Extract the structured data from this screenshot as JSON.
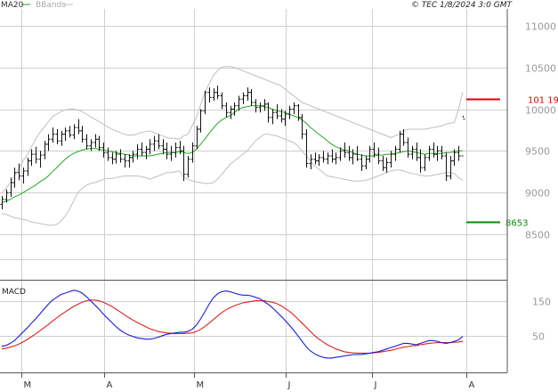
{
  "header": {
    "indicator_ma": "MA20",
    "indicator_bb": "BBands",
    "watermark": "© TEC 1/8/2024 3:0 GMT"
  },
  "colors": {
    "price_bars": "#111111",
    "ma20": "#22aa22",
    "bbands": "#c0c0c0",
    "macd_line": "#1a1adc",
    "signal_line": "#e02020",
    "resistance": "#e00000",
    "support": "#0a8a0a",
    "grid": "#cfcfcf",
    "axis_text": "#999999"
  },
  "chart_data": [
    {
      "type": "ohlc",
      "panel": "price",
      "ylim": [
        8000,
        11200
      ],
      "y_ticks": [
        {
          "value": 11000,
          "label": "11000"
        },
        {
          "value": 10500,
          "label": "10500"
        },
        {
          "value": 10000,
          "label": "10000"
        },
        {
          "value": 9500,
          "label": "9500"
        },
        {
          "value": 9000,
          "label": "9000"
        },
        {
          "value": 8500,
          "label": "8500"
        }
      ],
      "resistance": {
        "value": 10119,
        "label": "101 19"
      },
      "support": {
        "value": 8653,
        "label": "8653"
      },
      "ohlc": [
        [
          8860,
          8960,
          8800,
          8920
        ],
        [
          8920,
          9040,
          8880,
          9000
        ],
        [
          9000,
          9180,
          8950,
          9120
        ],
        [
          9120,
          9300,
          9060,
          9240
        ],
        [
          9240,
          9350,
          9150,
          9200
        ],
        [
          9200,
          9300,
          9110,
          9260
        ],
        [
          9260,
          9420,
          9200,
          9380
        ],
        [
          9380,
          9520,
          9320,
          9460
        ],
        [
          9460,
          9550,
          9350,
          9400
        ],
        [
          9400,
          9500,
          9300,
          9450
        ],
        [
          9450,
          9620,
          9400,
          9580
        ],
        [
          9580,
          9700,
          9500,
          9640
        ],
        [
          9640,
          9780,
          9600,
          9700
        ],
        [
          9700,
          9760,
          9580,
          9620
        ],
        [
          9620,
          9740,
          9560,
          9700
        ],
        [
          9700,
          9780,
          9620,
          9740
        ],
        [
          9740,
          9800,
          9660,
          9690
        ],
        [
          9690,
          9820,
          9640,
          9780
        ],
        [
          9780,
          9880,
          9700,
          9740
        ],
        [
          9740,
          9800,
          9600,
          9640
        ],
        [
          9640,
          9700,
          9520,
          9560
        ],
        [
          9560,
          9640,
          9500,
          9600
        ],
        [
          9600,
          9700,
          9540,
          9640
        ],
        [
          9640,
          9680,
          9500,
          9540
        ],
        [
          9540,
          9600,
          9420,
          9480
        ],
        [
          9480,
          9540,
          9380,
          9420
        ],
        [
          9420,
          9480,
          9340,
          9400
        ],
        [
          9400,
          9500,
          9350,
          9460
        ],
        [
          9460,
          9520,
          9360,
          9400
        ],
        [
          9400,
          9460,
          9300,
          9380
        ],
        [
          9380,
          9460,
          9300,
          9420
        ],
        [
          9420,
          9500,
          9360,
          9460
        ],
        [
          9460,
          9580,
          9400,
          9520
        ],
        [
          9520,
          9600,
          9440,
          9480
        ],
        [
          9480,
          9560,
          9400,
          9520
        ],
        [
          9520,
          9640,
          9460,
          9580
        ],
        [
          9580,
          9680,
          9500,
          9620
        ],
        [
          9620,
          9700,
          9520,
          9560
        ],
        [
          9560,
          9640,
          9460,
          9520
        ],
        [
          9520,
          9600,
          9400,
          9460
        ],
        [
          9460,
          9560,
          9380,
          9480
        ],
        [
          9480,
          9600,
          9420,
          9540
        ],
        [
          9540,
          9620,
          9460,
          9500
        ],
        [
          9500,
          9560,
          9140,
          9220
        ],
        [
          9220,
          9440,
          9180,
          9400
        ],
        [
          9400,
          9600,
          9360,
          9560
        ],
        [
          9560,
          9800,
          9520,
          9760
        ],
        [
          9760,
          10000,
          9720,
          9980
        ],
        [
          9980,
          10220,
          9940,
          10200
        ],
        [
          10200,
          10260,
          10080,
          10140
        ],
        [
          10140,
          10250,
          10100,
          10200
        ],
        [
          10200,
          10280,
          10120,
          10160
        ],
        [
          10160,
          10200,
          10000,
          10040
        ],
        [
          10040,
          10080,
          9900,
          9960
        ],
        [
          9960,
          10040,
          9880,
          10000
        ],
        [
          10000,
          10080,
          9920,
          10040
        ],
        [
          10040,
          10160,
          9980,
          10120
        ],
        [
          10120,
          10200,
          10060,
          10160
        ],
        [
          10160,
          10260,
          10100,
          10200
        ],
        [
          10200,
          10240,
          10040,
          10080
        ],
        [
          10080,
          10120,
          9960,
          10020
        ],
        [
          10020,
          10080,
          9960,
          10040
        ],
        [
          10040,
          10120,
          9980,
          10060
        ],
        [
          10060,
          10080,
          9840,
          9900
        ],
        [
          9900,
          10000,
          9820,
          9960
        ],
        [
          9960,
          10060,
          9880,
          9920
        ],
        [
          9920,
          10000,
          9840,
          9880
        ],
        [
          9880,
          9980,
          9800,
          9940
        ],
        [
          9940,
          10040,
          9880,
          10000
        ],
        [
          10000,
          10080,
          9940,
          10040
        ],
        [
          10040,
          10060,
          9860,
          9900
        ],
        [
          9900,
          9940,
          9640,
          9700
        ],
        [
          9700,
          9760,
          9300,
          9350
        ],
        [
          9350,
          9460,
          9280,
          9400
        ],
        [
          9400,
          9480,
          9340,
          9380
        ],
        [
          9380,
          9460,
          9320,
          9420
        ],
        [
          9420,
          9500,
          9360,
          9400
        ],
        [
          9400,
          9480,
          9340,
          9440
        ],
        [
          9440,
          9520,
          9360,
          9400
        ],
        [
          9400,
          9480,
          9340,
          9420
        ],
        [
          9420,
          9540,
          9380,
          9500
        ],
        [
          9500,
          9600,
          9420,
          9480
        ],
        [
          9480,
          9560,
          9380,
          9420
        ],
        [
          9420,
          9520,
          9340,
          9460
        ],
        [
          9460,
          9560,
          9380,
          9400
        ],
        [
          9400,
          9460,
          9260,
          9320
        ],
        [
          9320,
          9440,
          9280,
          9400
        ],
        [
          9400,
          9560,
          9360,
          9520
        ],
        [
          9520,
          9600,
          9420,
          9460
        ],
        [
          9460,
          9540,
          9340,
          9380
        ],
        [
          9380,
          9440,
          9260,
          9300
        ],
        [
          9300,
          9420,
          9240,
          9360
        ],
        [
          9360,
          9500,
          9300,
          9460
        ],
        [
          9460,
          9560,
          9380,
          9520
        ],
        [
          9520,
          9740,
          9480,
          9700
        ],
        [
          9700,
          9760,
          9560,
          9600
        ],
        [
          9600,
          9660,
          9420,
          9460
        ],
        [
          9460,
          9560,
          9400,
          9520
        ],
        [
          9520,
          9600,
          9380,
          9420
        ],
        [
          9420,
          9520,
          9240,
          9300
        ],
        [
          9300,
          9460,
          9260,
          9420
        ],
        [
          9420,
          9560,
          9380,
          9520
        ],
        [
          9520,
          9600,
          9420,
          9460
        ],
        [
          9460,
          9560,
          9380,
          9500
        ],
        [
          9500,
          9560,
          9400,
          9440
        ],
        [
          9440,
          9480,
          9140,
          9200
        ],
        [
          9200,
          9440,
          9160,
          9380
        ],
        [
          9380,
          9520,
          9320,
          9480
        ],
        [
          9480,
          9560,
          9380,
          9440
        ],
        [
          9440,
          9920,
          9900,
          9880
        ]
      ],
      "ma20": [
        8880,
        8900,
        8920,
        8950,
        8970,
        9000,
        9030,
        9060,
        9090,
        9130,
        9160,
        9200,
        9250,
        9300,
        9350,
        9400,
        9440,
        9470,
        9490,
        9510,
        9520,
        9530,
        9530,
        9520,
        9510,
        9500,
        9490,
        9480,
        9470,
        9460,
        9450,
        9440,
        9440,
        9440,
        9440,
        9440,
        9450,
        9460,
        9470,
        9480,
        9480,
        9480,
        9490,
        9480,
        9470,
        9480,
        9520,
        9580,
        9640,
        9710,
        9770,
        9830,
        9870,
        9900,
        9920,
        9960,
        10000,
        10020,
        10030,
        10040,
        10040,
        10040,
        10030,
        10020,
        10000,
        9980,
        9970,
        9960,
        9940,
        9920,
        9900,
        9870,
        9830,
        9780,
        9740,
        9700,
        9660,
        9620,
        9580,
        9550,
        9530,
        9510,
        9500,
        9480,
        9460,
        9450,
        9440,
        9440,
        9440,
        9450,
        9450,
        9460,
        9460,
        9470,
        9480,
        9490,
        9500,
        9490,
        9480,
        9470,
        9460,
        9470,
        9470,
        9470,
        9470,
        9480,
        9480,
        9490,
        9500,
        9500
      ],
      "bb_upper": [
        9000,
        9050,
        9120,
        9200,
        9280,
        9380,
        9450,
        9550,
        9640,
        9720,
        9780,
        9850,
        9910,
        9940,
        9970,
        9990,
        10000,
        10000,
        9990,
        9970,
        9940,
        9910,
        9880,
        9850,
        9820,
        9790,
        9760,
        9740,
        9720,
        9700,
        9690,
        9690,
        9700,
        9720,
        9730,
        9740,
        9720,
        9700,
        9680,
        9660,
        9650,
        9650,
        9640,
        9680,
        9700,
        9800,
        9900,
        10050,
        10200,
        10300,
        10400,
        10460,
        10500,
        10510,
        10510,
        10500,
        10480,
        10460,
        10440,
        10420,
        10400,
        10380,
        10360,
        10340,
        10320,
        10300,
        10280,
        10240,
        10200,
        10160,
        10120,
        10080,
        10060,
        10040,
        10020,
        10000,
        9980,
        9960,
        9940,
        9920,
        9900,
        9880,
        9860,
        9840,
        9820,
        9800,
        9780,
        9760,
        9740,
        9720,
        9700,
        9680,
        9660,
        9680,
        9700,
        9740,
        9760,
        9760,
        9760,
        9760,
        9760,
        9770,
        9780,
        9790,
        9800,
        9820,
        9830,
        9840,
        10000,
        10200
      ],
      "bb_lower": [
        8750,
        8740,
        8720,
        8700,
        8690,
        8680,
        8670,
        8650,
        8640,
        8630,
        8620,
        8610,
        8610,
        8620,
        8660,
        8720,
        8800,
        8900,
        9000,
        9050,
        9090,
        9110,
        9120,
        9140,
        9160,
        9170,
        9170,
        9180,
        9190,
        9200,
        9200,
        9200,
        9200,
        9190,
        9180,
        9160,
        9180,
        9200,
        9220,
        9240,
        9240,
        9250,
        9260,
        9190,
        9160,
        9140,
        9130,
        9120,
        9110,
        9110,
        9120,
        9160,
        9220,
        9280,
        9340,
        9380,
        9420,
        9460,
        9500,
        9560,
        9620,
        9660,
        9700,
        9700,
        9690,
        9680,
        9660,
        9640,
        9620,
        9600,
        9560,
        9500,
        9440,
        9380,
        9320,
        9280,
        9240,
        9200,
        9190,
        9180,
        9170,
        9160,
        9150,
        9140,
        9140,
        9140,
        9150,
        9160,
        9180,
        9200,
        9220,
        9240,
        9260,
        9270,
        9270,
        9260,
        9240,
        9230,
        9220,
        9210,
        9200,
        9200,
        9210,
        9220,
        9230,
        9240,
        9240,
        9230,
        9180,
        9150
      ]
    },
    {
      "type": "line",
      "panel": "macd",
      "title": "MACD",
      "ylim": [
        -50,
        200
      ],
      "y_ticks": [
        {
          "value": 150,
          "label": "150"
        },
        {
          "value": 50,
          "label": "50"
        }
      ],
      "x_labels": [
        "M",
        "A",
        "M",
        "J",
        "J",
        "A"
      ],
      "macd": [
        20,
        22,
        28,
        36,
        48,
        60,
        72,
        86,
        98,
        112,
        126,
        140,
        152,
        160,
        168,
        172,
        176,
        180,
        178,
        172,
        162,
        150,
        138,
        126,
        112,
        100,
        88,
        76,
        66,
        58,
        52,
        48,
        44,
        42,
        40,
        40,
        42,
        46,
        50,
        54,
        56,
        58,
        60,
        60,
        62,
        68,
        80,
        98,
        118,
        140,
        158,
        170,
        176,
        178,
        176,
        172,
        168,
        166,
        166,
        164,
        160,
        156,
        148,
        140,
        130,
        118,
        106,
        94,
        80,
        66,
        50,
        34,
        18,
        6,
        -2,
        -8,
        -12,
        -14,
        -14,
        -12,
        -10,
        -8,
        -6,
        -4,
        -4,
        -4,
        -2,
        0,
        2,
        4,
        8,
        12,
        16,
        20,
        24,
        28,
        28,
        26,
        24,
        28,
        32,
        36,
        36,
        34,
        30,
        28,
        30,
        34,
        38,
        48
      ],
      "signal": [
        12,
        14,
        17,
        21,
        26,
        32,
        39,
        47,
        55,
        64,
        73,
        82,
        92,
        101,
        110,
        118,
        126,
        134,
        140,
        146,
        150,
        152,
        152,
        150,
        146,
        140,
        134,
        126,
        118,
        110,
        102,
        95,
        88,
        82,
        76,
        70,
        66,
        62,
        60,
        58,
        57,
        56,
        56,
        56,
        57,
        58,
        62,
        68,
        76,
        86,
        96,
        106,
        116,
        124,
        130,
        136,
        140,
        144,
        146,
        148,
        150,
        150,
        150,
        148,
        146,
        142,
        136,
        128,
        120,
        110,
        98,
        86,
        74,
        62,
        50,
        40,
        32,
        24,
        18,
        12,
        8,
        4,
        2,
        1,
        0,
        0,
        0,
        0,
        1,
        2,
        4,
        6,
        8,
        11,
        14,
        17,
        19,
        21,
        22,
        24,
        26,
        28,
        29,
        30,
        30,
        30,
        30,
        31,
        32,
        34
      ]
    }
  ]
}
